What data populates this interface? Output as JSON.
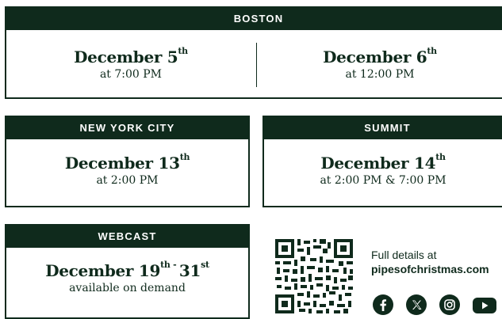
{
  "boston": {
    "header": "BOSTON",
    "left": {
      "date": "December 5",
      "suffix": "th",
      "time": "at 7:00 PM"
    },
    "right": {
      "date": "December 6",
      "suffix": "th",
      "time": "at 12:00 PM"
    }
  },
  "nyc": {
    "header": "NEW YORK CITY",
    "date": "December 13",
    "suffix": "th",
    "time": "at 2:00 PM"
  },
  "summit": {
    "header": "SUMMIT",
    "date": "December 14",
    "suffix": "th",
    "time": "at 2:00 PM & 7:00 PM"
  },
  "webcast": {
    "header": "WEBCAST",
    "date_start": "December 19",
    "suffix_start": "th",
    "dash": " - ",
    "date_end": "31",
    "suffix_end": "st",
    "time": "available on demand"
  },
  "details": {
    "label": "Full details at",
    "url": "pipesofchristmas.com"
  },
  "social": [
    "facebook-icon",
    "x-icon",
    "instagram-icon",
    "youtube-icon"
  ],
  "colors": {
    "primary": "#0f2a1c",
    "background": "#ffffff"
  }
}
